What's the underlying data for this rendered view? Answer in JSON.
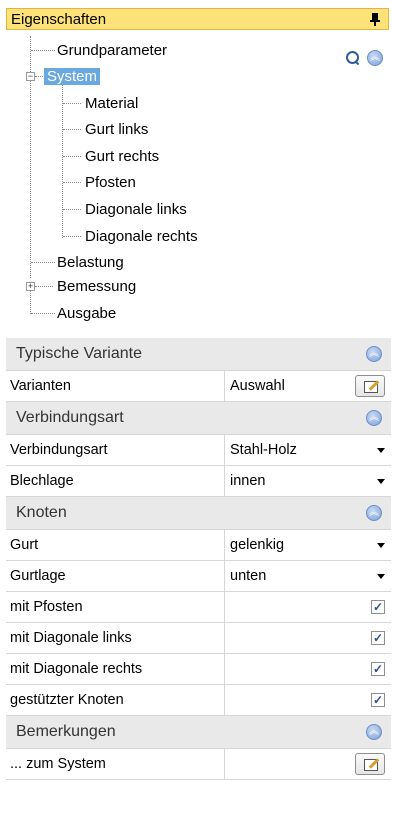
{
  "panel": {
    "title": "Eigenschaften"
  },
  "tree": {
    "items": [
      {
        "label": "Grundparameter"
      },
      {
        "label": "System",
        "expander": "−"
      },
      {
        "label": "Material"
      },
      {
        "label": "Gurt links"
      },
      {
        "label": "Gurt rechts"
      },
      {
        "label": "Pfosten"
      },
      {
        "label": "Diagonale links"
      },
      {
        "label": "Diagonale rechts"
      },
      {
        "label": "Belastung"
      },
      {
        "label": "Bemessung",
        "expander": "+"
      },
      {
        "label": "Ausgabe"
      }
    ],
    "selected": "System"
  },
  "grid": {
    "sections": [
      {
        "title": "Typische Variante"
      },
      {
        "title": "Verbindungsart"
      },
      {
        "title": "Knoten"
      },
      {
        "title": "Bemerkungen"
      }
    ],
    "rows": {
      "varianten": {
        "name": "Varianten",
        "value": "Auswahl"
      },
      "verbindungsart": {
        "name": "Verbindungsart",
        "value": "Stahl-Holz"
      },
      "blechlage": {
        "name": "Blechlage",
        "value": "innen"
      },
      "gurt": {
        "name": "Gurt",
        "value": "gelenkig"
      },
      "gurtlage": {
        "name": "Gurtlage",
        "value": "unten"
      },
      "mit_pfosten": {
        "name": "mit Pfosten",
        "checked": true
      },
      "mit_diag_links": {
        "name": "mit Diagonale links",
        "checked": true
      },
      "mit_diag_rechts": {
        "name": "mit Diagonale rechts",
        "checked": true
      },
      "gestuetzter": {
        "name": "gestützter Knoten",
        "checked": true
      },
      "zum_system": {
        "name": "... zum System",
        "value": ""
      }
    }
  },
  "icons": {
    "pin": "pin-icon",
    "search": "search-icon",
    "collapse": "collapse-all-icon",
    "section_collapse": "chevron-up-circle-icon",
    "dropdown": "dropdown-arrow-icon",
    "edit": "edit-icon",
    "check": "checkbox-checked-icon"
  },
  "colors": {
    "title_bg": "#fde27a",
    "selection": "#6aa8e0",
    "section_bg": "#e9e9e9"
  }
}
